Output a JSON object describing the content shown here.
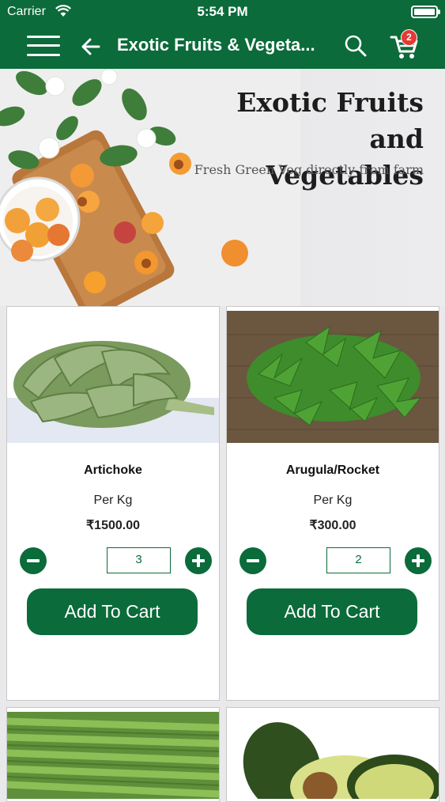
{
  "status": {
    "carrier": "Carrier",
    "time": "5:54 PM"
  },
  "nav": {
    "title": "Exotic Fruits & Vegeta...",
    "cart_count": "2"
  },
  "banner": {
    "title_line1": "Exotic Fruits and",
    "title_line2": "Vegetables",
    "subtitle": "Fresh Green Veg directly from farm"
  },
  "products": [
    {
      "name": "Artichoke",
      "unit": "Per Kg",
      "price": "₹1500.00",
      "qty": "3",
      "cta": "Add To Cart"
    },
    {
      "name": "Arugula/Rocket",
      "unit": "Per Kg",
      "price": "₹300.00",
      "qty": "2",
      "cta": "Add To Cart"
    }
  ],
  "colors": {
    "brand": "#0b6b3a",
    "badge": "#e53935"
  }
}
